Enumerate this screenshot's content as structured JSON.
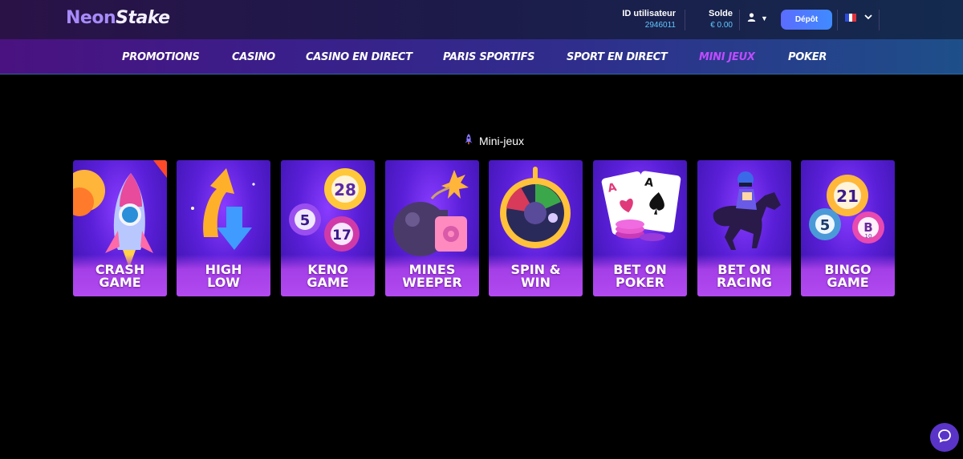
{
  "header": {
    "logo_part1": "Neon",
    "logo_part2": "Stake",
    "user_id_label": "ID utilisateur",
    "user_id_value": "2946011",
    "balance_label": "Solde",
    "balance_value": "€ 0.00",
    "deposit_label": "Dépôt",
    "language": "French flag"
  },
  "nav": {
    "items": [
      {
        "label": "PROMOTIONS"
      },
      {
        "label": "CASINO"
      },
      {
        "label": "CASINO EN DIRECT"
      },
      {
        "label": "PARIS SPORTIFS"
      },
      {
        "label": "SPORT EN DIRECT"
      },
      {
        "label": "MINI JEUX"
      },
      {
        "label": "POKER"
      }
    ],
    "active": "MINI JEUX",
    "active_color": "#c04bff"
  },
  "section": {
    "title": "Mini-jeux",
    "icon": "rocket-icon"
  },
  "games": [
    {
      "line1": "CRASH",
      "line2": "GAME",
      "icon": "rocket-icon"
    },
    {
      "line1": "HIGH",
      "line2": "LOW",
      "icon": "arrows-up-down-icon"
    },
    {
      "line1": "KENO",
      "line2": "GAME",
      "icon": "lottery-balls-icon",
      "balls": [
        "28",
        "5",
        "17"
      ]
    },
    {
      "line1": "MINES",
      "line2": "WEEPER",
      "icon": "bomb-icon"
    },
    {
      "line1": "SPIN &",
      "line2": "WIN",
      "icon": "wheel-icon"
    },
    {
      "line1": "BET ON",
      "line2": "POKER",
      "icon": "cards-chips-icon",
      "cards": [
        "A",
        "A"
      ]
    },
    {
      "line1": "BET ON",
      "line2": "RACING",
      "icon": "horse-jockey-icon"
    },
    {
      "line1": "BINGO",
      "line2": "GAME",
      "icon": "bingo-balls-icon",
      "balls": [
        "21",
        "5",
        "B",
        "10"
      ]
    }
  ],
  "support": {
    "icon": "chat-icon"
  }
}
